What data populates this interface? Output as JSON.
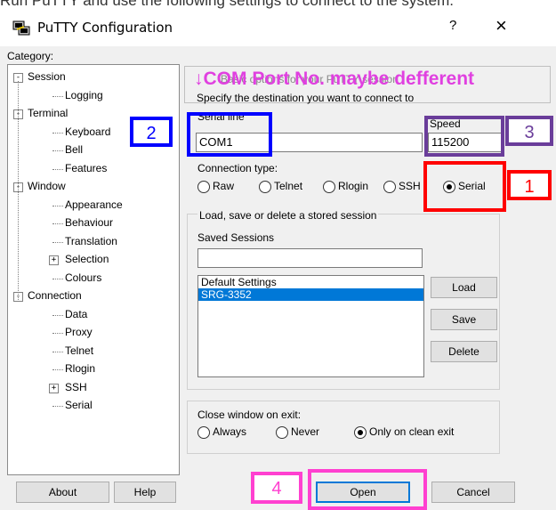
{
  "caption": "Run PuTTY and use the following settings to connect to the system.",
  "window": {
    "title": "PuTTY Configuration",
    "help": "?",
    "close": "×"
  },
  "category_label": "Category:",
  "tree": [
    {
      "label": "Session",
      "level": 0,
      "expander": "-"
    },
    {
      "label": "Logging",
      "level": 1
    },
    {
      "label": "Terminal",
      "level": 0,
      "expander": "-"
    },
    {
      "label": "Keyboard",
      "level": 1
    },
    {
      "label": "Bell",
      "level": 1
    },
    {
      "label": "Features",
      "level": 1
    },
    {
      "label": "Window",
      "level": 0,
      "expander": "-"
    },
    {
      "label": "Appearance",
      "level": 1
    },
    {
      "label": "Behaviour",
      "level": 1
    },
    {
      "label": "Translation",
      "level": 1
    },
    {
      "label": "Selection",
      "level": 1,
      "expander": "+"
    },
    {
      "label": "Colours",
      "level": 1
    },
    {
      "label": "Connection",
      "level": 0,
      "expander": "-"
    },
    {
      "label": "Data",
      "level": 1
    },
    {
      "label": "Proxy",
      "level": 1
    },
    {
      "label": "Telnet",
      "level": 1
    },
    {
      "label": "Rlogin",
      "level": 1
    },
    {
      "label": "SSH",
      "level": 1,
      "expander": "+"
    },
    {
      "label": "Serial",
      "level": 1
    }
  ],
  "overlay_note": "↓COM Port No. maybe defferent",
  "session": {
    "header_partial": "Basic options for your PuTTY session",
    "specify": "Specify the destination you want to connect to",
    "serial_line_label": "Serial line",
    "serial_line_value": "COM1",
    "speed_label": "Speed",
    "speed_value": "115200",
    "conn_type_label": "Connection type:",
    "conn_types": [
      "Raw",
      "Telnet",
      "Rlogin",
      "SSH",
      "Serial"
    ],
    "conn_selected": "Serial",
    "load_save_label": "Load, save or delete a stored session",
    "saved_sessions_label": "Saved Sessions",
    "saved_sessions_value": "",
    "sessions": [
      "Default Settings",
      "SRG-3352"
    ],
    "selected_session": "SRG-3352",
    "load": "Load",
    "save": "Save",
    "delete": "Delete",
    "close_label": "Close window on exit:",
    "close_options": [
      "Always",
      "Never",
      "Only on clean exit"
    ],
    "close_selected": "Only on clean exit"
  },
  "buttons": {
    "about": "About",
    "help": "Help",
    "open": "Open",
    "cancel": "Cancel"
  },
  "annotations": {
    "num1": "1",
    "num2": "2",
    "num3": "3",
    "num4": "4",
    "color_red": "#ff0000",
    "color_blue": "#0000ff",
    "color_purple": "#6a3d9a",
    "color_magenta": "#ff40d0"
  }
}
